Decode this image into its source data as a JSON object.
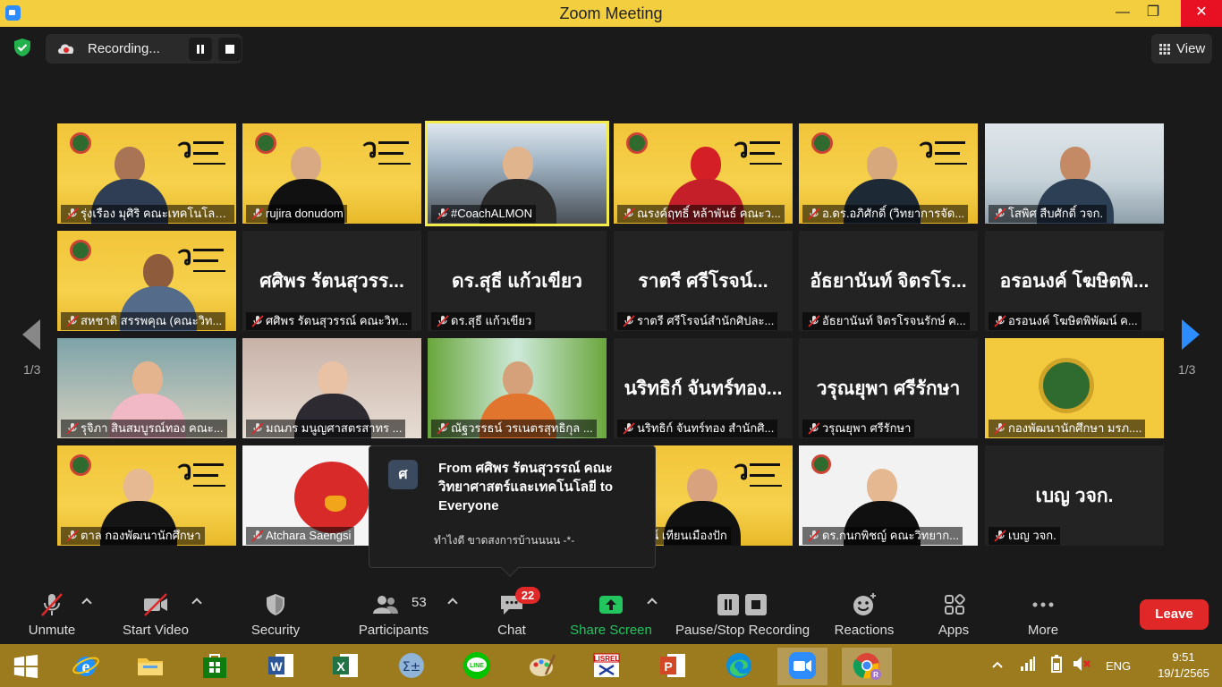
{
  "window": {
    "title": "Zoom Meeting",
    "minimize": "—",
    "maximize": "❐",
    "close": "✕"
  },
  "topbar": {
    "recording_label": "Recording...",
    "view_label": "View"
  },
  "gallery": {
    "page_indicator_left": "1/3",
    "page_indicator_right": "1/3",
    "tiles": [
      {
        "name": "รุ่งเรือง มุศิริ คณะเทคโนโลยี...",
        "big_name": "",
        "video": "poster-man-glasses",
        "muted": true
      },
      {
        "name": "rujira donudom",
        "big_name": "",
        "video": "poster-woman",
        "muted": true
      },
      {
        "name": "#CoachALMON",
        "big_name": "",
        "video": "coach",
        "muted": true
      },
      {
        "name": "ณรงค์ฤทธิ์ หล้าพันธ์ คณะว...",
        "big_name": "",
        "video": "poster-spiderman",
        "muted": true
      },
      {
        "name": "อ.ดร.อภิศักดิ์ (วิทยาการจัด...",
        "big_name": "",
        "video": "poster-man-young",
        "muted": true
      },
      {
        "name": "โสพิศ สืบศักดิ์ วจก.",
        "big_name": "",
        "video": "outdoor-woman",
        "muted": true
      },
      {
        "name": "สหชาติ สรรพคุณ (คณะวิท...",
        "big_name": "",
        "video": "poster-man-older",
        "muted": true
      },
      {
        "name": "ศศิพร รัตนสุวรรณ์ คณะวิท...",
        "big_name": "ศศิพร รัตนสุวรร...",
        "video": "",
        "muted": true
      },
      {
        "name": "ดร.สุธี แก้วเขียว",
        "big_name": "ดร.สุธี  แก้วเขียว",
        "video": "",
        "muted": true
      },
      {
        "name": "ราตรี  ศรีโรจน์สำนักศิปละ...",
        "big_name": "ราตรี   ศรีโรจน์...",
        "video": "",
        "muted": true
      },
      {
        "name": "อัธยานันท์ จิตรโรจนรักษ์ ค...",
        "big_name": "อัธยานันท์ จิตรโร...",
        "video": "",
        "muted": true
      },
      {
        "name": "อรอนงค์ โฆษิตพิพัฒน์ ค...",
        "big_name": "อรอนงค์ โฆษิตพิ...",
        "video": "",
        "muted": true
      },
      {
        "name": "รุจิภา สินสมบูรณ์ทอง คณะ...",
        "big_name": "",
        "video": "room-girl",
        "muted": true
      },
      {
        "name": "มณภร มนูญศาสตรสาทร ...",
        "big_name": "",
        "video": "room-woman",
        "muted": true
      },
      {
        "name": "ณัฐวรรธน์ วรเนตรสุทธิกุล ...",
        "big_name": "",
        "video": "stage-man",
        "muted": true
      },
      {
        "name": "นริทธิก์ จันทร์ทอง สำนักศิ...",
        "big_name": "นริทธิก์ จันทร์ทอง...",
        "video": "",
        "muted": true
      },
      {
        "name": "วรุณยุพา ศรีรักษา",
        "big_name": "วรุณยุพา ศรีรักษา",
        "video": "",
        "muted": true
      },
      {
        "name": "กองพัฒนานักศึกษา มรภ....",
        "big_name": "",
        "video": "poster-seal",
        "muted": true
      },
      {
        "name": "ตาล กองพัฒนานักศึกษา",
        "big_name": "",
        "video": "poster-woman-suit",
        "muted": true
      },
      {
        "name": "Atchara Saengsi",
        "big_name": "",
        "video": "angry-bird",
        "muted": true
      },
      {
        "name": "",
        "big_name": "",
        "video": "hidden",
        "muted": false
      },
      {
        "name": "รัตน์ เทียนเมืองปัก",
        "big_name": "",
        "video": "poster-woman-round",
        "muted": false
      },
      {
        "name": "ดร.กนกพิชญ์ คณะวิทยาก...",
        "big_name": "",
        "video": "poster-woman-white",
        "muted": true
      },
      {
        "name": "เบญ วจก.",
        "big_name": "เบญ วจก.",
        "video": "",
        "muted": true
      }
    ]
  },
  "chat_popup": {
    "avatar_letter": "ศ",
    "from": "From ศศิพร รัตนสุวรรณ์ คณะวิทยาศาสตร์และเทคโนโลยี to Everyone",
    "message": "ทำไงดี ขาดสงการบ้านนนน -*-"
  },
  "toolbar": {
    "unmute": "Unmute",
    "start_video": "Start Video",
    "security": "Security",
    "participants": "Participants",
    "participants_count": "53",
    "chat": "Chat",
    "chat_badge": "22",
    "share_screen": "Share Screen",
    "pause_stop_recording": "Pause/Stop Recording",
    "reactions": "Reactions",
    "apps": "Apps",
    "more": "More",
    "leave": "Leave"
  },
  "taskbar": {
    "apps": [
      "start",
      "internet-explorer",
      "file-explorer",
      "store",
      "word",
      "excel",
      "calculator",
      "line",
      "paint",
      "lisrel",
      "powerpoint",
      "edge",
      "zoom",
      "chrome"
    ],
    "language": "ENG",
    "time": "9:51",
    "date": "19/1/2565"
  },
  "colors": {
    "accent_blue": "#2d8cff",
    "leave_red": "#e02828",
    "share_green": "#22c55e",
    "title_yellow": "#f3cf3f",
    "active_speaker": "#f3ec4a"
  }
}
